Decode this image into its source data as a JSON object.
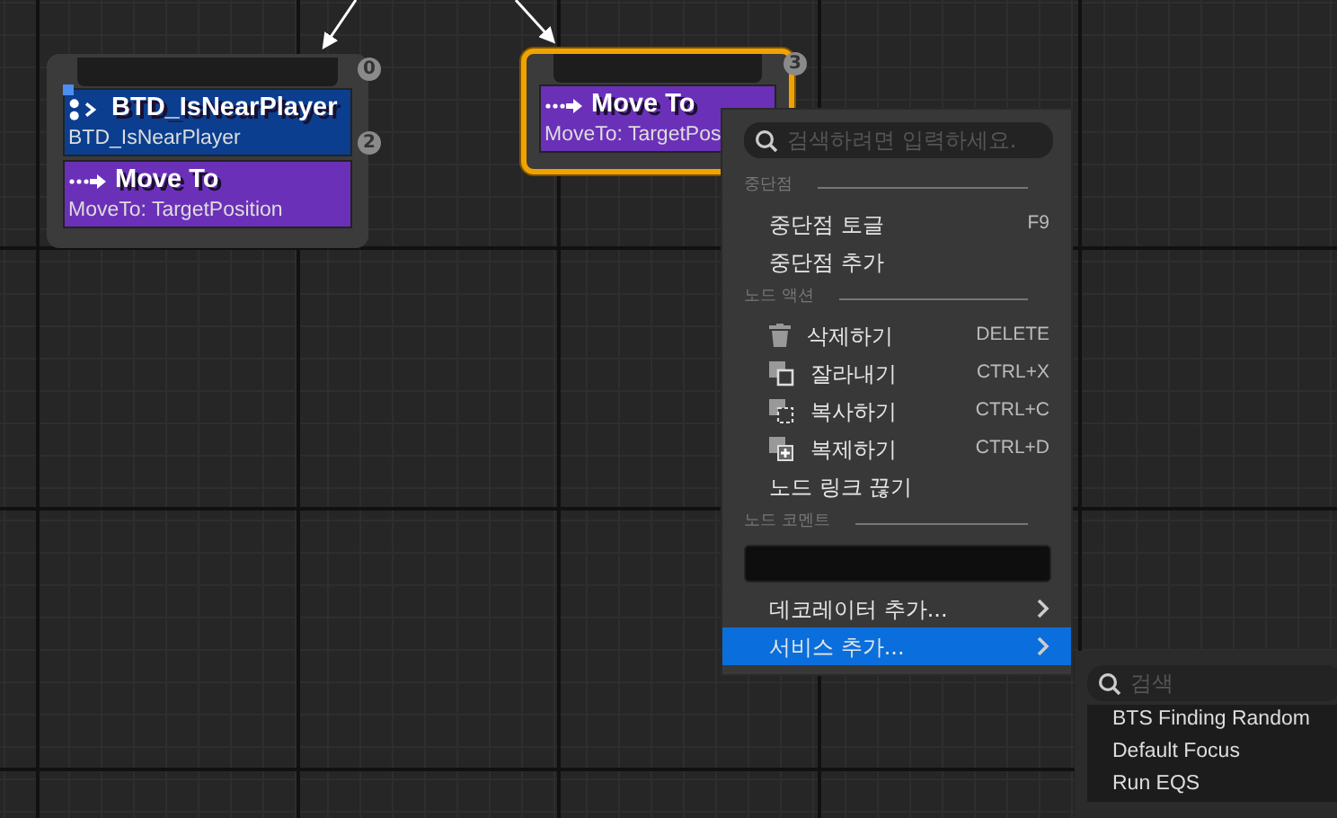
{
  "nodes": [
    {
      "index": "0",
      "selected": false,
      "children": [
        {
          "kind": "decorator",
          "title": "BTD_IsNearPlayer",
          "subtitle": "BTD_IsNearPlayer",
          "index": "2"
        },
        {
          "kind": "task",
          "title": "Move To",
          "subtitle": "MoveTo: TargetPosition"
        }
      ]
    },
    {
      "index": "3",
      "selected": true,
      "children": [
        {
          "kind": "task",
          "title": "Move To",
          "subtitle": "MoveTo: TargetPos"
        }
      ]
    }
  ],
  "context_menu": {
    "search": {
      "placeholder": "검색하려면 입력하세요."
    },
    "sections": [
      {
        "heading": "중단점",
        "items": [
          {
            "kind": "plain",
            "label": "중단점 토글",
            "shortcut": "F9",
            "selected": false
          },
          {
            "kind": "plain",
            "label": "중단점 추가",
            "selected": false
          }
        ]
      },
      {
        "heading": "노드 액션",
        "items": [
          {
            "kind": "delete",
            "label": "삭제하기",
            "shortcut": "DELETE",
            "selected": false
          },
          {
            "kind": "cut",
            "label": "잘라내기",
            "shortcut": "CTRL+X",
            "selected": false
          },
          {
            "kind": "copy",
            "label": "복사하기",
            "shortcut": "CTRL+C",
            "selected": false
          },
          {
            "kind": "duplicate",
            "label": "복제하기",
            "shortcut": "CTRL+D",
            "selected": false
          },
          {
            "kind": "plain",
            "label": "노드 링크 끊기",
            "selected": false
          }
        ]
      },
      {
        "heading": "노드 코멘트",
        "items": [
          {
            "kind": "field"
          },
          {
            "kind": "submenu",
            "label": "데코레이터 추가...",
            "selected": false
          },
          {
            "kind": "submenu",
            "label": "서비스 추가...",
            "selected": true
          }
        ]
      }
    ]
  },
  "submenu": {
    "search": {
      "placeholder": "검색"
    },
    "items": [
      {
        "label": "BTS Finding Random",
        "selected": false
      },
      {
        "label": "Default Focus",
        "selected": false
      },
      {
        "label": "Run EQS",
        "selected": false
      }
    ]
  }
}
